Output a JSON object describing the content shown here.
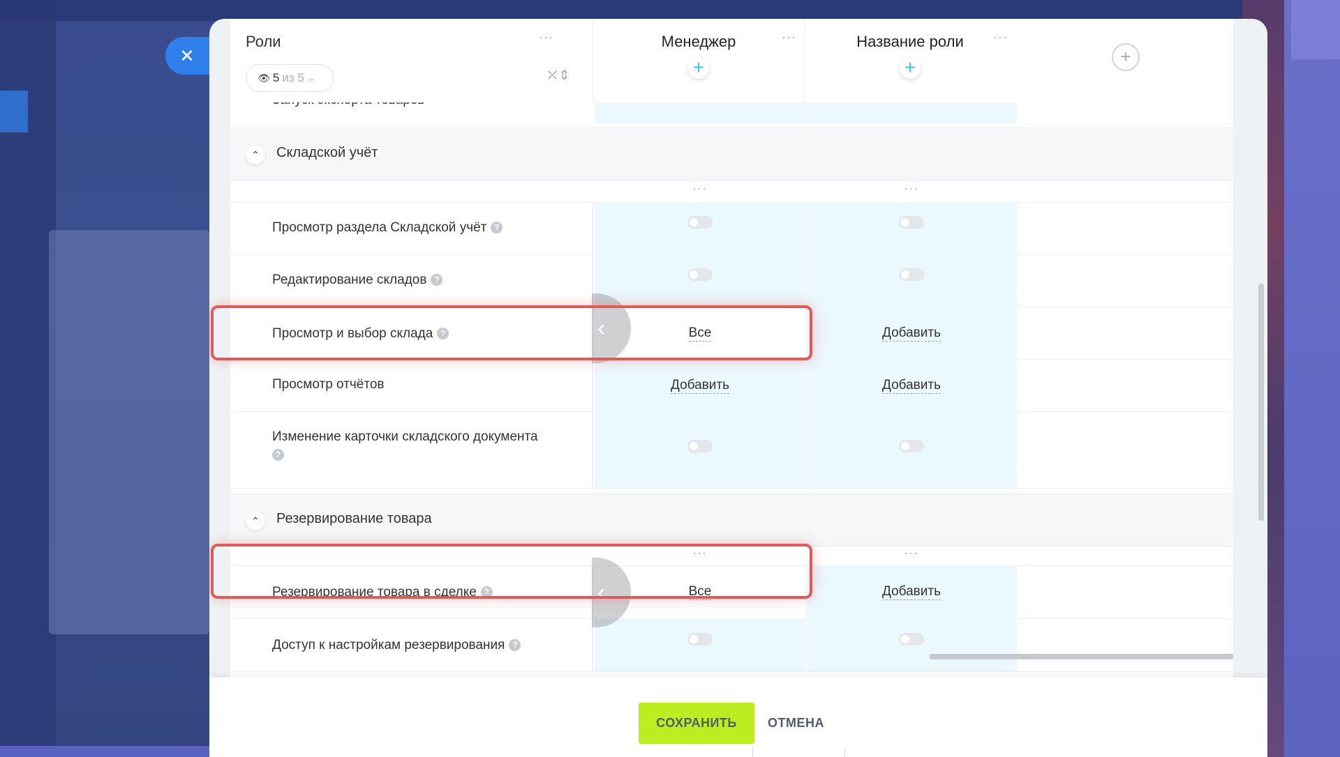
{
  "dialog": {
    "close_icon": "close-icon"
  },
  "header": {
    "title": "Роли",
    "counter_value": "5",
    "counter_suffix": "из 5",
    "columns": [
      {
        "name": "Менеджер"
      },
      {
        "name": "Название роли"
      }
    ]
  },
  "cut_row_label": "Запуск экспорта товаров",
  "sections": [
    {
      "title": "Складской учёт",
      "rows": [
        {
          "label": "Просмотр раздела Складской учёт",
          "values": [
            "toggle-off",
            "toggle-off"
          ]
        },
        {
          "label": "Редактирование складов",
          "values": [
            "toggle-off",
            "toggle-off"
          ]
        },
        {
          "label": "Просмотр и выбор склада",
          "values": [
            "Все",
            "Добавить"
          ],
          "highlighted": true
        },
        {
          "label": "Просмотр отчётов",
          "values": [
            "Добавить",
            "Добавить"
          ]
        },
        {
          "label": "Изменение карточки складского документа",
          "values": [
            "toggle-off",
            "toggle-off"
          ]
        }
      ]
    },
    {
      "title": "Резервирование товара",
      "rows": [
        {
          "label": "Резервирование товара в сделке",
          "values": [
            "Все",
            "Добавить"
          ],
          "highlighted": true
        },
        {
          "label": "Доступ к настройкам резервирования",
          "values": [
            "toggle-off",
            "toggle-off"
          ]
        }
      ]
    }
  ],
  "footer": {
    "save_label": "СОХРАНИТЬ",
    "cancel_label": "ОТМЕНА"
  },
  "colors": {
    "accent": "#2fc6f6",
    "save": "#bbed21",
    "highlight": "#e15a5a",
    "close": "#2f80ed"
  }
}
